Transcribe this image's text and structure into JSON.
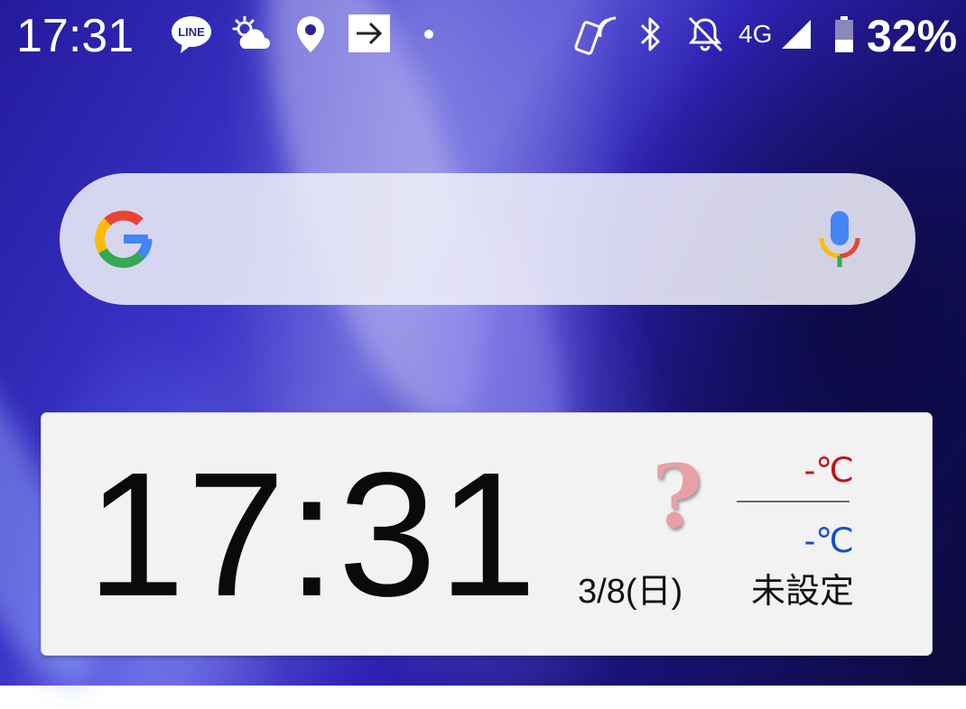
{
  "status_bar": {
    "time": "17:31",
    "network": "4G",
    "battery": "32%",
    "icons": [
      "line-icon",
      "weather-icon",
      "location-icon",
      "forward-icon",
      "dot-icon",
      "nfc-icon",
      "bluetooth-icon",
      "silent-icon",
      "signal-icon",
      "battery-icon"
    ],
    "line_logo_text": "LINE"
  },
  "search_bar": {
    "icons": [
      "google-logo-icon",
      "microphone-icon"
    ]
  },
  "clock_widget": {
    "time": "17:31",
    "weather_symbol": "?",
    "temp_high": "-℃",
    "temp_low": "-℃",
    "date": "3/8(日)",
    "location": "未設定"
  },
  "colors": {
    "temp_high": "#c0141c",
    "temp_low": "#1452c4",
    "widget_bg": "#f2f2f3"
  }
}
